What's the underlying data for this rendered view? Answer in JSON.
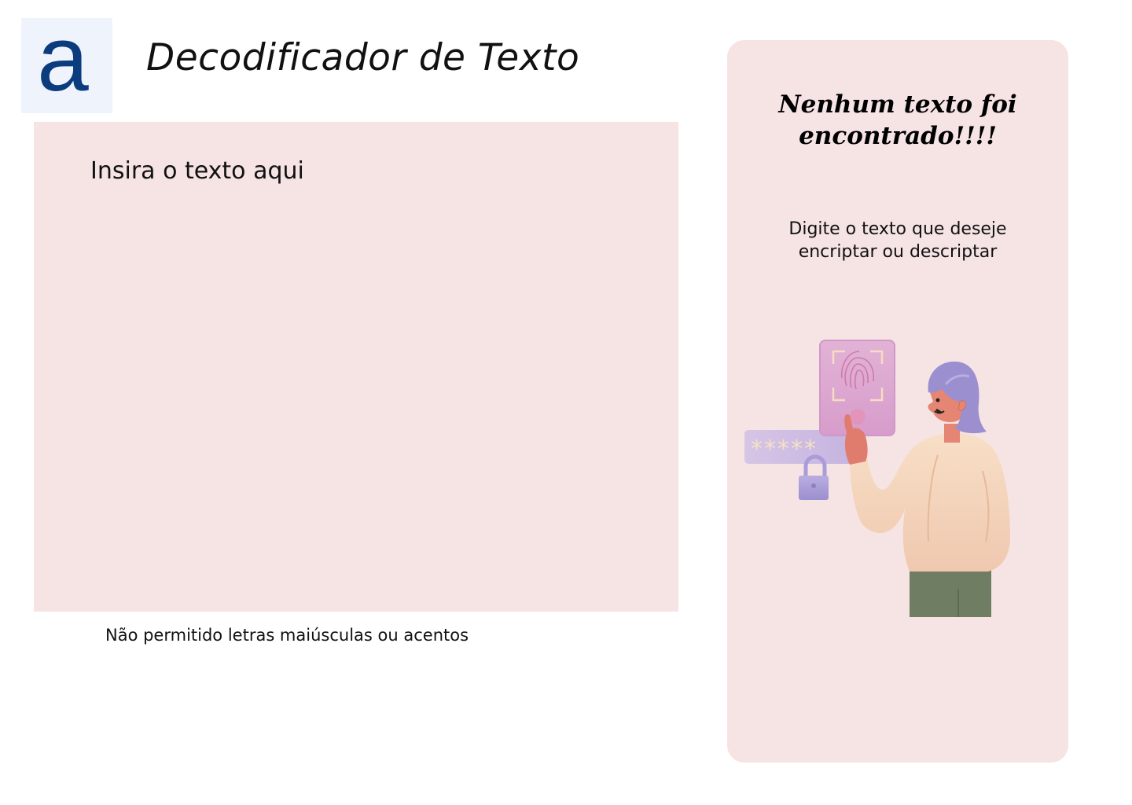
{
  "logo": {
    "letter": "a"
  },
  "header": {
    "title": "Decodificador de Texto"
  },
  "input": {
    "placeholder": "Insira o texto aqui",
    "value": ""
  },
  "hint": "Não permitido letras maiúsculas ou acentos",
  "output": {
    "title": "Nenhum texto foi encontrado!!!!",
    "subtitle": "Digite o texto que deseje encriptar ou descriptar",
    "illustration_icon": "person-fingerprint-illustration",
    "password_mask": "*****"
  },
  "colors": {
    "panel_bg": "#f6e3e4",
    "logo_bg": "#eff3fb",
    "logo_fg": "#0b3c7d",
    "text": "#111111"
  }
}
